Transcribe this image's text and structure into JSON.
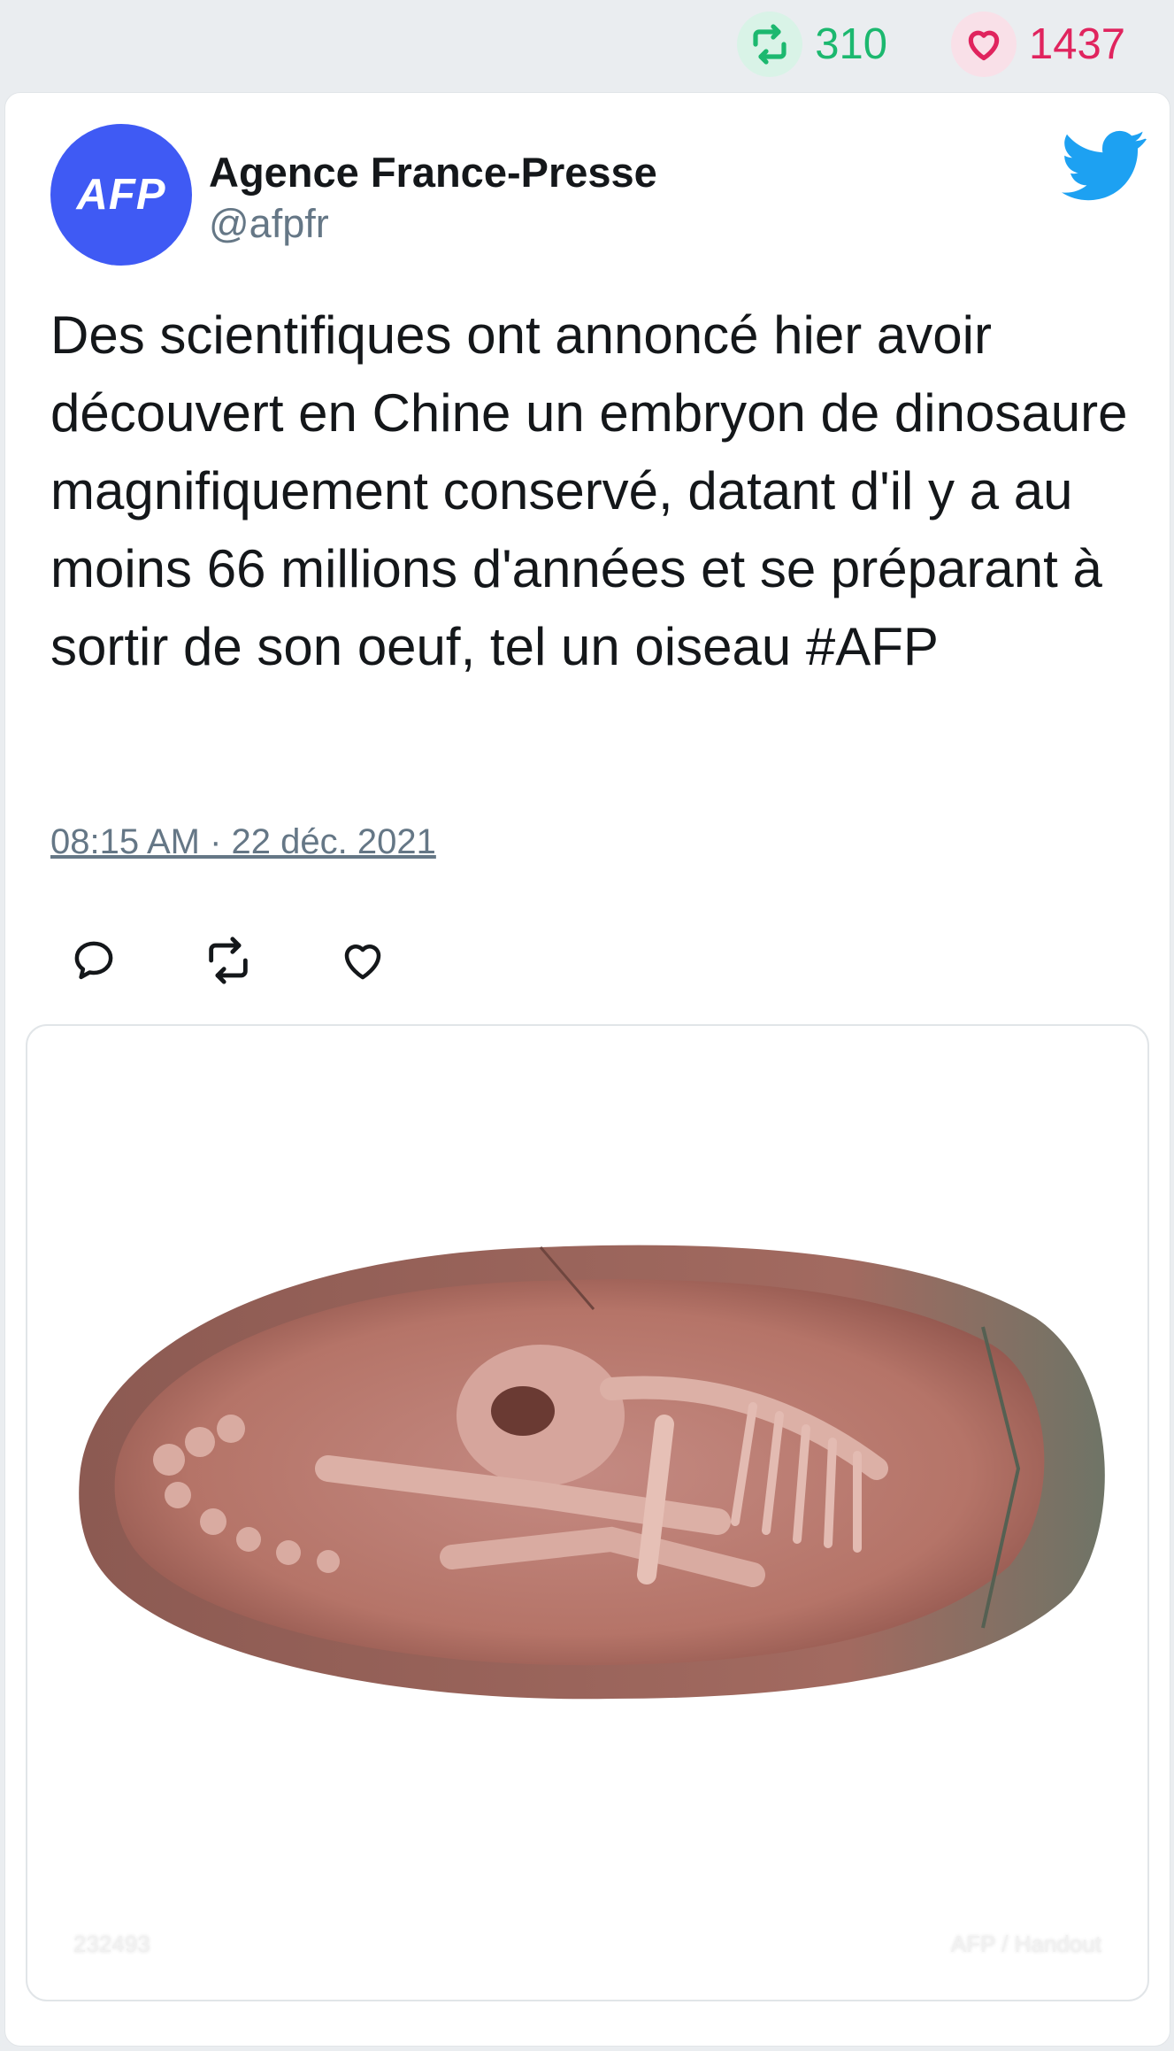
{
  "stats": {
    "retweets": "310",
    "likes": "1437",
    "retweet_color": "#1cb86f",
    "like_color": "#e0245e"
  },
  "author": {
    "avatar_text": "AFP",
    "avatar_color": "#3f5af4",
    "name": "Agence France-Presse",
    "handle": "@afpfr"
  },
  "tweet": {
    "text": "Des scientifiques ont annoncé hier avoir découvert en Chine un embryon de dinosaure magnifiquement conservé, datant d'il y a au moins 66 millions d'années et se préparant à sortir de son oeuf, tel un oiseau #AFP",
    "timestamp": "08:15 AM · 22 déc. 2021"
  },
  "actions": {
    "icons": [
      "comment-icon",
      "retweet-icon",
      "like-icon"
    ]
  },
  "media": {
    "credit_left": "232493",
    "credit_right": "AFP / Handout"
  },
  "icons": {
    "brand": "twitter-bird-icon",
    "brand_color": "#1da1f2"
  }
}
